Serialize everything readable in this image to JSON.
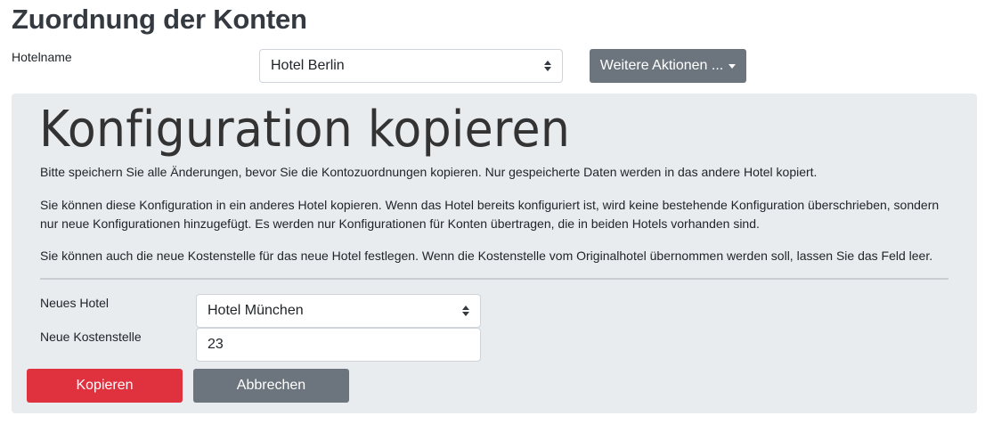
{
  "header": {
    "title": "Zuordnung der Konten",
    "hotel_label": "Hotelname",
    "hotel_value": "Hotel Berlin",
    "more_actions_label": "Weitere Aktionen ..."
  },
  "panel": {
    "title": "Konfiguration kopieren",
    "paragraphs": [
      "Bitte speichern Sie alle Änderungen, bevor Sie die Kontozuordnungen kopieren. Nur gespeicherte Daten werden in das andere Hotel kopiert.",
      "Sie können diese Konfiguration in ein anderes Hotel kopieren. Wenn das Hotel bereits konfiguriert ist, wird keine bestehende Konfiguration überschrieben, sondern nur neue Konfigurationen hinzugefügt. Es werden nur Konfigurationen für Konten übertragen, die in beiden Hotels vorhanden sind.",
      "Sie können auch die neue Kostenstelle für das neue Hotel festlegen. Wenn die Kostenstelle vom Originalhotel übernommen werden soll, lassen Sie das Feld leer."
    ],
    "new_hotel_label": "Neues Hotel",
    "new_hotel_value": "Hotel München",
    "new_cost_center_label": "Neue Kostenstelle",
    "new_cost_center_value": "23",
    "copy_label": "Kopieren",
    "cancel_label": "Abbrechen"
  },
  "colors": {
    "primary_danger": "#e0313e",
    "secondary": "#6c757d",
    "panel_bg": "#e9ecef"
  },
  "icons": {
    "select_arrows": "sort-arrows-icon",
    "dropdown_caret": "caret-down-icon"
  }
}
